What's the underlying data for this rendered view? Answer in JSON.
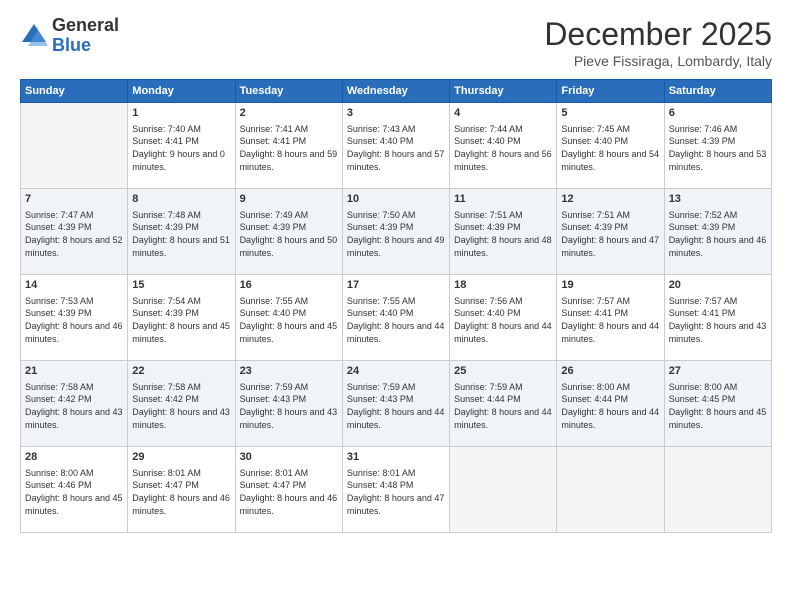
{
  "logo": {
    "line1": "General",
    "line2": "Blue"
  },
  "header": {
    "month": "December 2025",
    "location": "Pieve Fissiraga, Lombardy, Italy"
  },
  "weekdays": [
    "Sunday",
    "Monday",
    "Tuesday",
    "Wednesday",
    "Thursday",
    "Friday",
    "Saturday"
  ],
  "weeks": [
    [
      {
        "day": "",
        "sunrise": "",
        "sunset": "",
        "daylight": ""
      },
      {
        "day": "1",
        "sunrise": "Sunrise: 7:40 AM",
        "sunset": "Sunset: 4:41 PM",
        "daylight": "Daylight: 9 hours and 0 minutes."
      },
      {
        "day": "2",
        "sunrise": "Sunrise: 7:41 AM",
        "sunset": "Sunset: 4:41 PM",
        "daylight": "Daylight: 8 hours and 59 minutes."
      },
      {
        "day": "3",
        "sunrise": "Sunrise: 7:43 AM",
        "sunset": "Sunset: 4:40 PM",
        "daylight": "Daylight: 8 hours and 57 minutes."
      },
      {
        "day": "4",
        "sunrise": "Sunrise: 7:44 AM",
        "sunset": "Sunset: 4:40 PM",
        "daylight": "Daylight: 8 hours and 56 minutes."
      },
      {
        "day": "5",
        "sunrise": "Sunrise: 7:45 AM",
        "sunset": "Sunset: 4:40 PM",
        "daylight": "Daylight: 8 hours and 54 minutes."
      },
      {
        "day": "6",
        "sunrise": "Sunrise: 7:46 AM",
        "sunset": "Sunset: 4:39 PM",
        "daylight": "Daylight: 8 hours and 53 minutes."
      }
    ],
    [
      {
        "day": "7",
        "sunrise": "Sunrise: 7:47 AM",
        "sunset": "Sunset: 4:39 PM",
        "daylight": "Daylight: 8 hours and 52 minutes."
      },
      {
        "day": "8",
        "sunrise": "Sunrise: 7:48 AM",
        "sunset": "Sunset: 4:39 PM",
        "daylight": "Daylight: 8 hours and 51 minutes."
      },
      {
        "day": "9",
        "sunrise": "Sunrise: 7:49 AM",
        "sunset": "Sunset: 4:39 PM",
        "daylight": "Daylight: 8 hours and 50 minutes."
      },
      {
        "day": "10",
        "sunrise": "Sunrise: 7:50 AM",
        "sunset": "Sunset: 4:39 PM",
        "daylight": "Daylight: 8 hours and 49 minutes."
      },
      {
        "day": "11",
        "sunrise": "Sunrise: 7:51 AM",
        "sunset": "Sunset: 4:39 PM",
        "daylight": "Daylight: 8 hours and 48 minutes."
      },
      {
        "day": "12",
        "sunrise": "Sunrise: 7:51 AM",
        "sunset": "Sunset: 4:39 PM",
        "daylight": "Daylight: 8 hours and 47 minutes."
      },
      {
        "day": "13",
        "sunrise": "Sunrise: 7:52 AM",
        "sunset": "Sunset: 4:39 PM",
        "daylight": "Daylight: 8 hours and 46 minutes."
      }
    ],
    [
      {
        "day": "14",
        "sunrise": "Sunrise: 7:53 AM",
        "sunset": "Sunset: 4:39 PM",
        "daylight": "Daylight: 8 hours and 46 minutes."
      },
      {
        "day": "15",
        "sunrise": "Sunrise: 7:54 AM",
        "sunset": "Sunset: 4:39 PM",
        "daylight": "Daylight: 8 hours and 45 minutes."
      },
      {
        "day": "16",
        "sunrise": "Sunrise: 7:55 AM",
        "sunset": "Sunset: 4:40 PM",
        "daylight": "Daylight: 8 hours and 45 minutes."
      },
      {
        "day": "17",
        "sunrise": "Sunrise: 7:55 AM",
        "sunset": "Sunset: 4:40 PM",
        "daylight": "Daylight: 8 hours and 44 minutes."
      },
      {
        "day": "18",
        "sunrise": "Sunrise: 7:56 AM",
        "sunset": "Sunset: 4:40 PM",
        "daylight": "Daylight: 8 hours and 44 minutes."
      },
      {
        "day": "19",
        "sunrise": "Sunrise: 7:57 AM",
        "sunset": "Sunset: 4:41 PM",
        "daylight": "Daylight: 8 hours and 44 minutes."
      },
      {
        "day": "20",
        "sunrise": "Sunrise: 7:57 AM",
        "sunset": "Sunset: 4:41 PM",
        "daylight": "Daylight: 8 hours and 43 minutes."
      }
    ],
    [
      {
        "day": "21",
        "sunrise": "Sunrise: 7:58 AM",
        "sunset": "Sunset: 4:42 PM",
        "daylight": "Daylight: 8 hours and 43 minutes."
      },
      {
        "day": "22",
        "sunrise": "Sunrise: 7:58 AM",
        "sunset": "Sunset: 4:42 PM",
        "daylight": "Daylight: 8 hours and 43 minutes."
      },
      {
        "day": "23",
        "sunrise": "Sunrise: 7:59 AM",
        "sunset": "Sunset: 4:43 PM",
        "daylight": "Daylight: 8 hours and 43 minutes."
      },
      {
        "day": "24",
        "sunrise": "Sunrise: 7:59 AM",
        "sunset": "Sunset: 4:43 PM",
        "daylight": "Daylight: 8 hours and 44 minutes."
      },
      {
        "day": "25",
        "sunrise": "Sunrise: 7:59 AM",
        "sunset": "Sunset: 4:44 PM",
        "daylight": "Daylight: 8 hours and 44 minutes."
      },
      {
        "day": "26",
        "sunrise": "Sunrise: 8:00 AM",
        "sunset": "Sunset: 4:44 PM",
        "daylight": "Daylight: 8 hours and 44 minutes."
      },
      {
        "day": "27",
        "sunrise": "Sunrise: 8:00 AM",
        "sunset": "Sunset: 4:45 PM",
        "daylight": "Daylight: 8 hours and 45 minutes."
      }
    ],
    [
      {
        "day": "28",
        "sunrise": "Sunrise: 8:00 AM",
        "sunset": "Sunset: 4:46 PM",
        "daylight": "Daylight: 8 hours and 45 minutes."
      },
      {
        "day": "29",
        "sunrise": "Sunrise: 8:01 AM",
        "sunset": "Sunset: 4:47 PM",
        "daylight": "Daylight: 8 hours and 46 minutes."
      },
      {
        "day": "30",
        "sunrise": "Sunrise: 8:01 AM",
        "sunset": "Sunset: 4:47 PM",
        "daylight": "Daylight: 8 hours and 46 minutes."
      },
      {
        "day": "31",
        "sunrise": "Sunrise: 8:01 AM",
        "sunset": "Sunset: 4:48 PM",
        "daylight": "Daylight: 8 hours and 47 minutes."
      },
      {
        "day": "",
        "sunrise": "",
        "sunset": "",
        "daylight": ""
      },
      {
        "day": "",
        "sunrise": "",
        "sunset": "",
        "daylight": ""
      },
      {
        "day": "",
        "sunrise": "",
        "sunset": "",
        "daylight": ""
      }
    ]
  ]
}
